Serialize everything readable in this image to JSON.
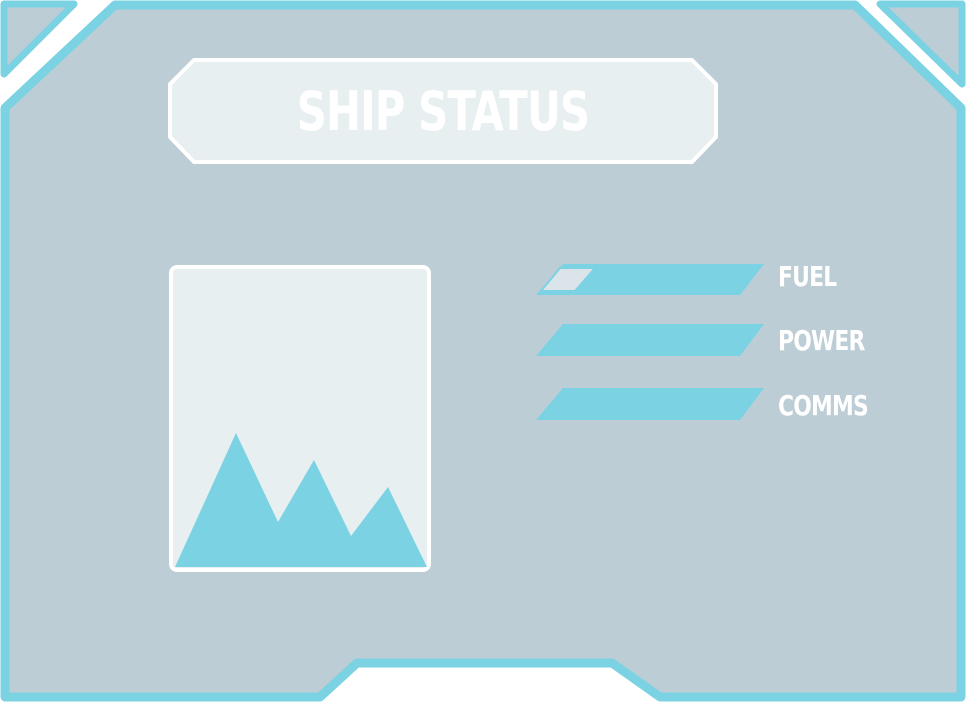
{
  "title": "SHIP STATUS",
  "image_placeholder": {
    "icon": "mountains-icon"
  },
  "stats": [
    {
      "label": "FUEL",
      "level": 0.1
    },
    {
      "label": "POWER",
      "level": 0
    },
    {
      "label": "COMMS",
      "level": 0
    }
  ],
  "colors": {
    "frame_border": "#7ad2e2",
    "panel_fill": "#bccdd6",
    "light_fill": "#e8eff1",
    "bar_fill": "#7ad2e2",
    "text": "#ffffff"
  }
}
